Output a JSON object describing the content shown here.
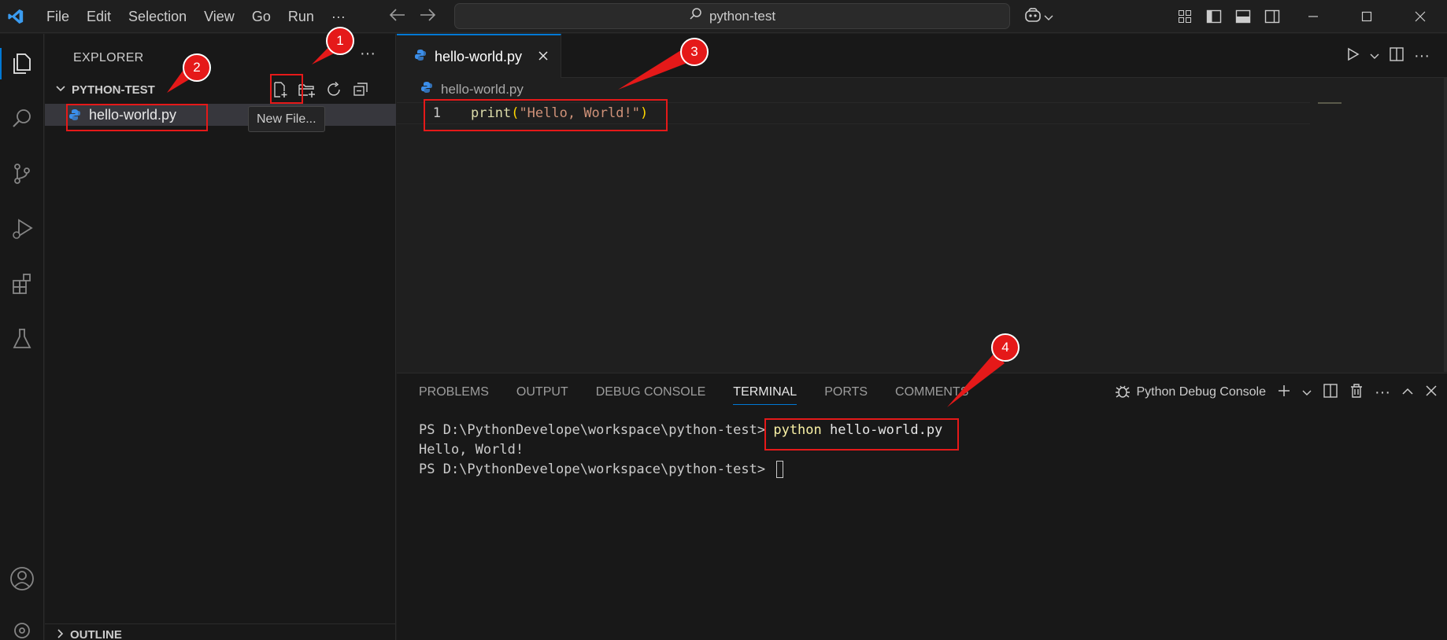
{
  "titlebar": {
    "menu": [
      "File",
      "Edit",
      "Selection",
      "View",
      "Go",
      "Run",
      "···"
    ],
    "search": "python-test"
  },
  "explorer": {
    "title": "EXPLORER",
    "more": "···",
    "folder": "PYTHON-TEST",
    "files": [
      "hello-world.py"
    ],
    "tooltip": "New File...",
    "outline": "OUTLINE"
  },
  "editor": {
    "tab_label": "hello-world.py",
    "breadcrumb": "hello-world.py",
    "lines": [
      {
        "num": "1",
        "fn": "print",
        "open": "(",
        "str": "\"Hello, World!\"",
        "close": ")"
      }
    ]
  },
  "panel": {
    "tabs": [
      "PROBLEMS",
      "OUTPUT",
      "DEBUG CONSOLE",
      "TERMINAL",
      "PORTS",
      "COMMENTS"
    ],
    "active_tab": "TERMINAL",
    "debug_console_label": "Python Debug Console",
    "terminal": {
      "prompt": "PS D:\\PythonDevelope\\workspace\\python-test> ",
      "command": "python",
      "arg": " hello-world.py",
      "output": "Hello, World!",
      "prompt2": "PS D:\\PythonDevelope\\workspace\\python-test> "
    }
  },
  "annotations": [
    "1",
    "2",
    "3",
    "4"
  ],
  "colors": {
    "accent": "#0078d4",
    "annotation": "#e51919",
    "python_icon": "#3b8eea"
  }
}
